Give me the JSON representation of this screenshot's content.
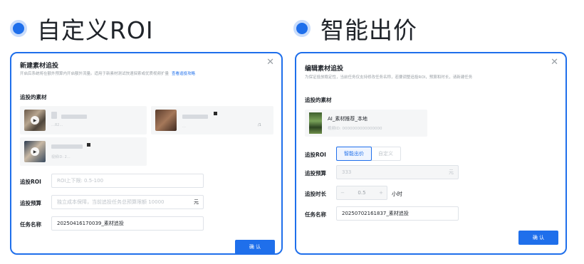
{
  "left": {
    "heading": "自定义ROI",
    "dialog": {
      "title": "新建素材追投",
      "desc": "开启后系统将在额外预算内开启额外流量。适用于新素材测试快速探索或优质视频扩量",
      "desc_link": "查看追投攻略",
      "materials_label": "追投的素材",
      "assets": [
        {
          "meta": "…82…",
          "badge": "…"
        },
        {
          "meta": "…",
          "badge": "/1"
        },
        {
          "meta": "视频ID: 2…"
        }
      ],
      "roi_label": "追投ROI",
      "roi_placeholder": "ROI上下限: 0.5-100",
      "budget_label": "追投预算",
      "budget_placeholder": "独立成本保障，当前追投任务总预算限额 10000",
      "budget_unit": "元",
      "name_label": "任务名称",
      "name_value": "20250416170039_素材追投",
      "confirm": "确 认"
    }
  },
  "right": {
    "heading": "智能出价",
    "dialog": {
      "title": "编辑素材追投",
      "desc": "为保证投放稳定性，当前任务仅支持修改任务名称，若要调整追投ROI，预算和时长，请新建任务",
      "materials_label": "追投的素材",
      "asset_name": "AI_素材推荐_本地",
      "asset_id": "视频ID: 0000000000000000",
      "roi_label": "追投ROI",
      "roi_options": [
        "智能出价",
        "自定义"
      ],
      "budget_label": "追投预算",
      "budget_value": "333",
      "budget_unit": "元",
      "duration_label": "追投时长",
      "duration_value": "0.5",
      "duration_minus": "−",
      "duration_plus": "+",
      "duration_unit": "小时",
      "name_label": "任务名称",
      "name_value": "20250702161837_素材追投",
      "confirm": "确 认"
    }
  },
  "colors": {
    "accent": "#1f6feb",
    "border": "#dfe3e8",
    "muted": "#9aa0a6"
  },
  "icons": {
    "close": "close-icon",
    "play": "play-icon",
    "bullet": "bullet-dot-icon"
  }
}
